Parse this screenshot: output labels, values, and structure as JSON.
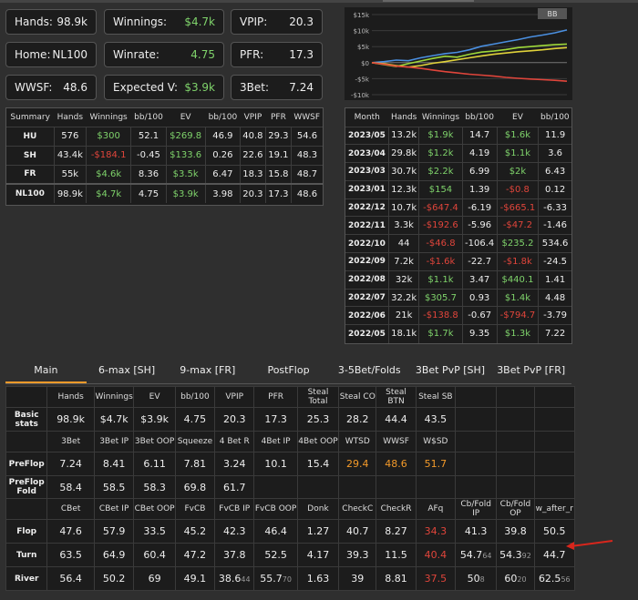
{
  "stats": [
    {
      "label": "Hands:",
      "value": "98.9k",
      "color": ""
    },
    {
      "label": "Winnings:",
      "value": "$4.7k",
      "color": "g"
    },
    {
      "label": "VPIP:",
      "value": "20.3",
      "color": ""
    },
    {
      "label": "Home:",
      "value": "NL100",
      "color": ""
    },
    {
      "label": "Winrate:",
      "value": "4.75",
      "color": "g"
    },
    {
      "label": "PFR:",
      "value": "17.3",
      "color": ""
    },
    {
      "label": "WWSF:",
      "value": "48.6",
      "color": ""
    },
    {
      "label": "Expected V:",
      "value": "$3.9k",
      "color": "g"
    },
    {
      "label": "3Bet:",
      "value": "7.24",
      "color": ""
    }
  ],
  "summary": {
    "headers": [
      "Summary",
      "Hands",
      "Winnings",
      "bb/100",
      "EV",
      "bb/100",
      "VPIP",
      "PFR",
      "WWSF"
    ],
    "rows": [
      {
        "c": [
          "HU",
          "576",
          "$300",
          "52.1",
          "$269.8",
          "46.9",
          "40.8",
          "29.3",
          "54.6"
        ],
        "col": [
          "",
          "",
          "g",
          "",
          "g",
          "",
          "",
          "",
          ""
        ]
      },
      {
        "c": [
          "SH",
          "43.4k",
          "-$184.1",
          "-0.45",
          "$133.6",
          "0.26",
          "22.6",
          "19.1",
          "48.3"
        ],
        "col": [
          "",
          "",
          "r",
          "",
          "g",
          "",
          "",
          "",
          ""
        ]
      },
      {
        "c": [
          "FR",
          "55k",
          "$4.6k",
          "8.36",
          "$3.5k",
          "6.47",
          "18.3",
          "15.8",
          "48.7"
        ],
        "col": [
          "",
          "",
          "g",
          "",
          "g",
          "",
          "",
          "",
          ""
        ]
      },
      {
        "c": [
          "NL100",
          "98.9k",
          "$4.7k",
          "4.75",
          "$3.9k",
          "3.98",
          "20.3",
          "17.3",
          "48.6"
        ],
        "col": [
          "",
          "",
          "g",
          "",
          "g",
          "",
          "",
          "",
          ""
        ]
      }
    ]
  },
  "chart": {
    "badge": "BB",
    "yticks": [
      "$15k",
      "$10k",
      "$5k",
      "$0",
      "-$5k",
      "-$10k"
    ]
  },
  "chart_data": {
    "type": "line",
    "ylim": [
      -10000,
      15000
    ],
    "yticks": [
      15000,
      10000,
      5000,
      0,
      -5000,
      -10000
    ],
    "series": [
      {
        "color": "#4a8fe0",
        "values": [
          0,
          300,
          800,
          600,
          1500,
          2200,
          2800,
          3200,
          4000,
          5100,
          5800,
          6500,
          7200,
          8000,
          8600,
          9300,
          10200
        ]
      },
      {
        "color": "#9ed83a",
        "values": [
          0,
          -600,
          -1200,
          -300,
          500,
          1300,
          2000,
          1700,
          2600,
          3300,
          3600,
          4100,
          4700,
          5000,
          5300,
          5600,
          5800
        ]
      },
      {
        "color": "#e0d23a",
        "values": [
          0,
          -300,
          -900,
          -1400,
          -900,
          -200,
          300,
          900,
          1500,
          2100,
          2600,
          3000,
          3400,
          3700,
          4000,
          4400,
          4700
        ]
      },
      {
        "color": "#e0453b",
        "values": [
          0,
          -500,
          -1100,
          -1400,
          -1800,
          -2300,
          -2800,
          -3200,
          -3600,
          -3900,
          -4200,
          -4600,
          -4900,
          -5100,
          -5300,
          -5500,
          -5800
        ]
      }
    ]
  },
  "months": {
    "headers": [
      "Month",
      "Hands",
      "Winnings",
      "bb/100",
      "EV",
      "bb/100"
    ],
    "rows": [
      {
        "c": [
          "2023/05",
          "13.2k",
          "$1.9k",
          "14.7",
          "$1.6k",
          "11.9"
        ],
        "col": [
          "",
          "",
          "g",
          "",
          "g",
          ""
        ]
      },
      {
        "c": [
          "2023/04",
          "29.8k",
          "$1.2k",
          "4.19",
          "$1.1k",
          "3.6"
        ],
        "col": [
          "",
          "",
          "g",
          "",
          "g",
          ""
        ]
      },
      {
        "c": [
          "2023/03",
          "30.7k",
          "$2.2k",
          "6.99",
          "$2k",
          "6.43"
        ],
        "col": [
          "",
          "",
          "g",
          "",
          "g",
          ""
        ]
      },
      {
        "c": [
          "2023/01",
          "12.3k",
          "$154",
          "1.39",
          "-$0.8",
          "0.12"
        ],
        "col": [
          "",
          "",
          "g",
          "",
          "r",
          ""
        ]
      },
      {
        "c": [
          "2022/12",
          "10.7k",
          "-$647.4",
          "-6.19",
          "-$665.1",
          "-6.33"
        ],
        "col": [
          "",
          "",
          "r",
          "",
          "r",
          ""
        ]
      },
      {
        "c": [
          "2022/11",
          "3.3k",
          "-$192.6",
          "-5.96",
          "-$47.2",
          "-1.46"
        ],
        "col": [
          "",
          "",
          "r",
          "",
          "r",
          ""
        ]
      },
      {
        "c": [
          "2022/10",
          "44",
          "-$46.8",
          "-106.4",
          "$235.2",
          "534.6"
        ],
        "col": [
          "",
          "",
          "r",
          "",
          "g",
          ""
        ]
      },
      {
        "c": [
          "2022/09",
          "7.2k",
          "-$1.6k",
          "-22.7",
          "-$1.8k",
          "-24.5"
        ],
        "col": [
          "",
          "",
          "r",
          "",
          "r",
          ""
        ]
      },
      {
        "c": [
          "2022/08",
          "32k",
          "$1.1k",
          "3.47",
          "$440.1",
          "1.41"
        ],
        "col": [
          "",
          "",
          "g",
          "",
          "g",
          ""
        ]
      },
      {
        "c": [
          "2022/07",
          "32.2k",
          "$305.7",
          "0.93",
          "$1.4k",
          "4.48"
        ],
        "col": [
          "",
          "",
          "g",
          "",
          "g",
          ""
        ]
      },
      {
        "c": [
          "2022/06",
          "21k",
          "-$138.8",
          "-0.67",
          "-$794.7",
          "-3.79"
        ],
        "col": [
          "",
          "",
          "r",
          "",
          "r",
          ""
        ]
      },
      {
        "c": [
          "2022/05",
          "18.1k",
          "$1.7k",
          "9.35",
          "$1.3k",
          "7.22"
        ],
        "col": [
          "",
          "",
          "g",
          "",
          "g",
          ""
        ]
      }
    ]
  },
  "tabs": [
    "Main",
    "6-max [SH]",
    "9-max [FR]",
    "PostFlop",
    "3-5Bet/Folds",
    "3Bet PvP [SH]",
    "3Bet PvP [FR]"
  ],
  "main": {
    "rows": [
      {
        "type": "hd",
        "cells": [
          "",
          "Hands",
          "Winnings",
          "EV",
          "bb/100",
          "VPIP",
          "PFR",
          "Steal Total",
          "Steal CO",
          "Steal BTN",
          "Steal SB",
          "",
          "",
          "",
          ""
        ]
      },
      {
        "type": "val",
        "label": "Basic stats",
        "cells": [
          "98.9k",
          "$4.7k",
          "$3.9k",
          "4.75",
          "20.3",
          "17.3",
          "25.3",
          "28.2",
          "44.4",
          "43.5",
          "",
          "",
          "",
          ""
        ],
        "col": [
          "",
          "",
          "",
          "",
          "",
          "",
          "",
          "",
          "",
          "",
          "",
          "",
          "",
          ""
        ]
      },
      {
        "type": "hd",
        "cells": [
          "",
          "3Bet",
          "3Bet IP",
          "3Bet OOP",
          "Squeeze",
          "4 Bet R",
          "4Bet IP",
          "4Bet OOP",
          "WTSD",
          "WWSF",
          "W$SD",
          "",
          "",
          "",
          ""
        ]
      },
      {
        "type": "val",
        "label": "PreFlop",
        "cells": [
          "7.24",
          "8.41",
          "6.11",
          "7.81",
          "3.24",
          "10.1",
          "15.4",
          "29.4",
          "48.6",
          "51.7",
          "",
          "",
          "",
          ""
        ],
        "col": [
          "",
          "",
          "",
          "",
          "",
          "",
          "",
          "o",
          "o",
          "o",
          "",
          "",
          "",
          ""
        ]
      },
      {
        "type": "val",
        "label": "PreFlop Fold",
        "cells": [
          "58.4",
          "58.5",
          "58.3",
          "69.8",
          "61.7",
          "",
          "",
          "",
          "",
          "",
          "",
          "",
          "",
          ""
        ],
        "col": [
          "",
          "",
          "",
          "",
          "",
          "",
          "",
          "",
          "",
          "",
          "",
          "",
          "",
          ""
        ]
      },
      {
        "type": "hd",
        "cells": [
          "",
          "CBet",
          "CBet IP",
          "CBet OOP",
          "FvCB",
          "FvCB IP",
          "FvCB OOP",
          "Donk",
          "CheckC",
          "CheckR",
          "AFq",
          "Cb/Fold IP",
          "Cb/Fold OP",
          "w_after_r"
        ]
      },
      {
        "type": "val",
        "label": "Flop",
        "cells": [
          "47.6",
          "57.9",
          "33.5",
          "45.2",
          "42.3",
          "46.4",
          "1.27",
          "40.7",
          "8.27",
          "34.3",
          "41.3",
          "39.8",
          "50.5"
        ],
        "col": [
          "",
          "",
          "",
          "",
          "",
          "",
          "",
          "",
          "",
          "r",
          "",
          "",
          ""
        ]
      },
      {
        "type": "val",
        "label": "Turn",
        "cells": [
          "63.5",
          "64.9",
          "60.4",
          "47.2",
          "37.8",
          "52.5",
          "4.17",
          "39.3",
          "11.5",
          "40.4",
          "54.7",
          "54.3",
          "44.7"
        ],
        "sub": [
          "",
          "",
          "",
          "",
          "",
          "",
          "",
          "",
          "",
          "",
          "64",
          "92",
          ""
        ],
        "col": [
          "",
          "",
          "",
          "",
          "",
          "",
          "",
          "",
          "",
          "r",
          "",
          "",
          ""
        ]
      },
      {
        "type": "val",
        "label": "River",
        "cells": [
          "56.4",
          "50.2",
          "69",
          "49.1",
          "38.6",
          "55.7",
          "1.63",
          "39",
          "8.81",
          "37.5",
          "50",
          "60",
          "62.5"
        ],
        "sub": [
          "",
          "",
          "",
          "",
          "44",
          "70",
          "",
          "",
          "",
          "",
          "8",
          "20",
          "56"
        ],
        "col": [
          "",
          "",
          "",
          "",
          "",
          "",
          "",
          "",
          "",
          "r",
          "",
          "",
          ""
        ]
      }
    ]
  }
}
